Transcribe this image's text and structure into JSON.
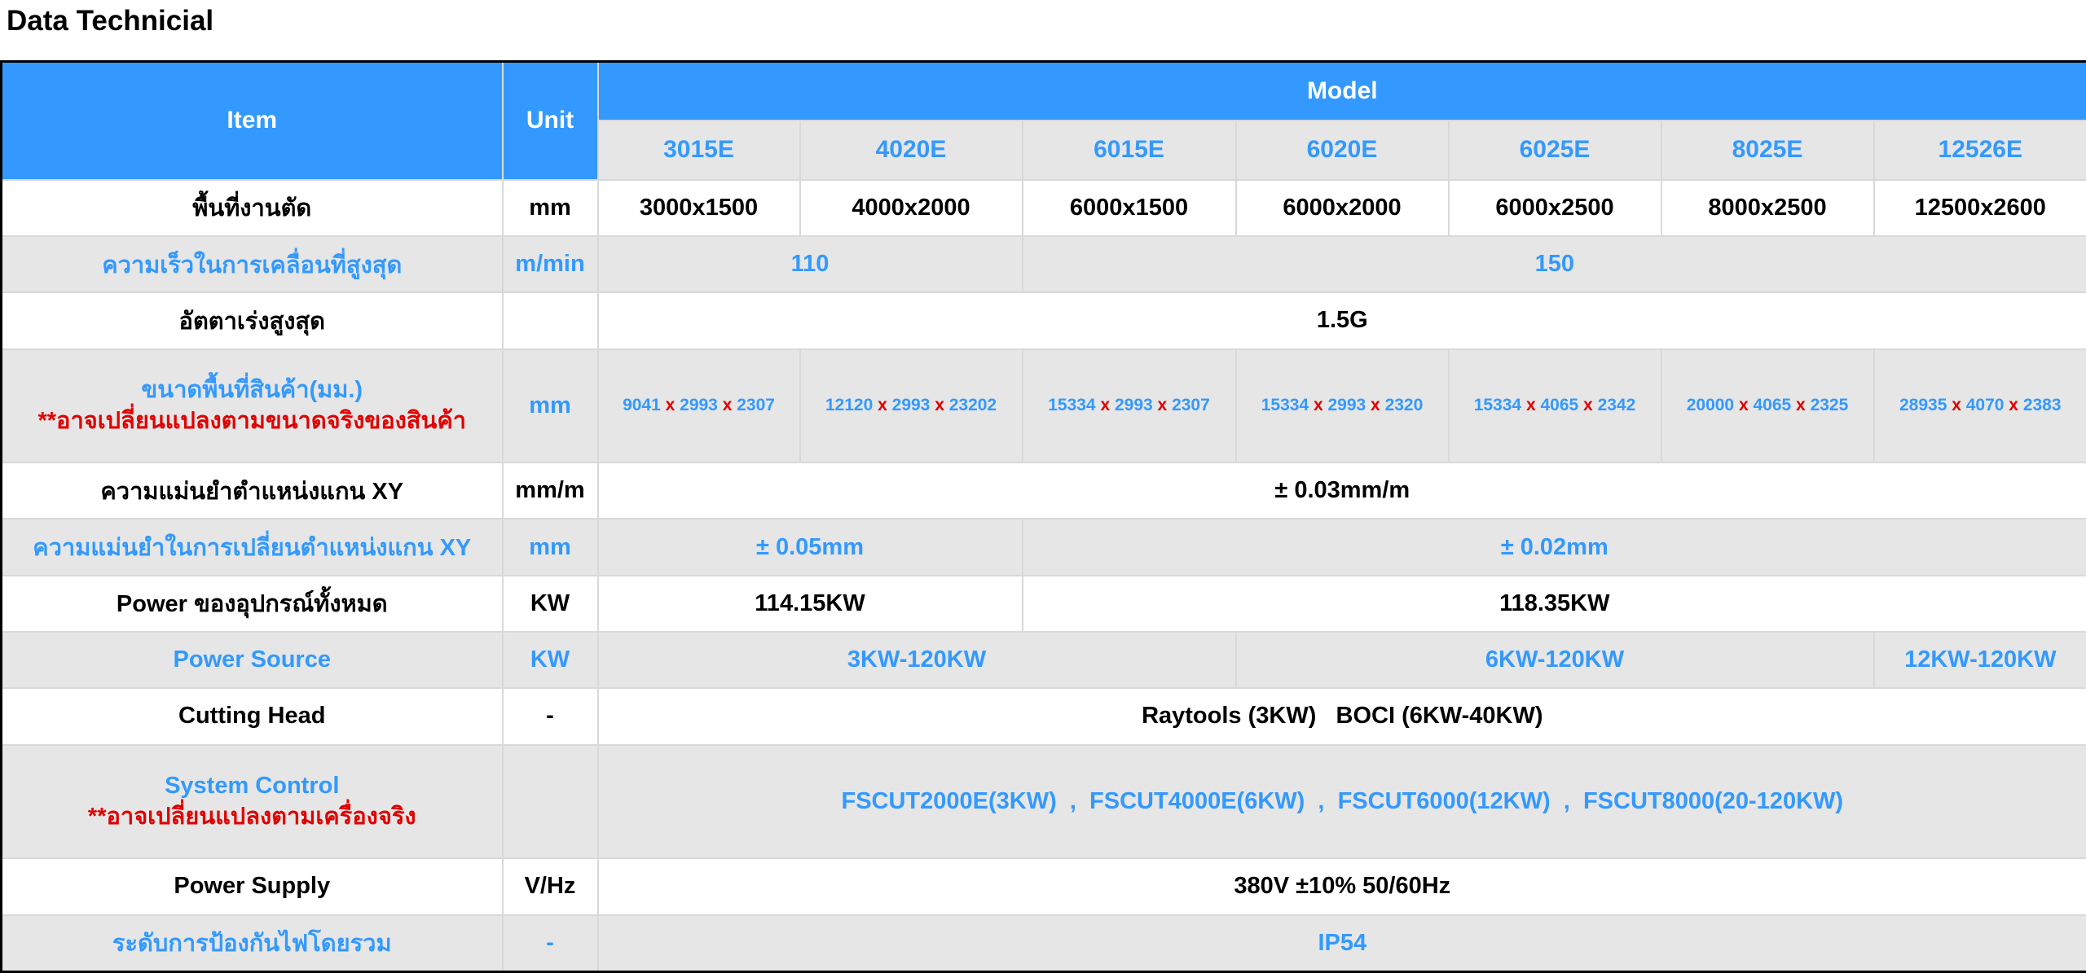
{
  "title": "Data Technicial",
  "header": {
    "item": "Item",
    "unit": "Unit",
    "model": "Model",
    "models": [
      "3015E",
      "4020E",
      "6015E",
      "6020E",
      "6025E",
      "8025E",
      "12526E"
    ]
  },
  "rows": {
    "work_area": {
      "item": "พื้นที่งานตัด",
      "unit": "mm",
      "values": [
        "3000x1500",
        "4000x2000",
        "6000x1500",
        "6000x2000",
        "6000x2500",
        "8000x2500",
        "12500x2600"
      ]
    },
    "max_speed": {
      "item": "ความเร็วในการเคลื่อนที่สูงสุด",
      "unit": "m/min",
      "values": [
        "110",
        "150"
      ]
    },
    "max_accel": {
      "item": "อัตตาเร่งสูงสุด",
      "unit": "",
      "value": "1.5G"
    },
    "footprint": {
      "item": "ขนาดพื้นที่สินค้า(มม.)",
      "note": "**อาจเปลี่ยนแปลงตามขนาดจริงของสินค้า",
      "unit": "mm",
      "separator": "x",
      "values": [
        [
          "9041",
          "2993",
          "2307"
        ],
        [
          "12120",
          "2993",
          "23202"
        ],
        [
          "15334",
          "2993",
          "2307"
        ],
        [
          "15334",
          "2993",
          "2320"
        ],
        [
          "15334",
          "4065",
          "2342"
        ],
        [
          "20000",
          "4065",
          "2325"
        ],
        [
          "28935",
          "4070",
          "2383"
        ]
      ]
    },
    "xy_accuracy": {
      "item": "ความแม่นยำตำแหน่งแกน XY",
      "unit": "mm/m",
      "value": "± 0.03mm/m"
    },
    "xy_repeat": {
      "item": "ความแม่นยำในการเปลี่ยนตำแหน่งแกน XY",
      "unit": "mm",
      "values": [
        "± 0.05mm",
        "± 0.02mm"
      ]
    },
    "total_power": {
      "item": "Power ของอุปกรณ์ทั้งหมด",
      "unit": "KW",
      "values": [
        "114.15KW",
        "118.35KW"
      ]
    },
    "power_source": {
      "item": "Power Source",
      "unit": "KW",
      "values": [
        "3KW-120KW",
        "6KW-120KW",
        "12KW-120KW"
      ]
    },
    "cutting_head": {
      "item": "Cutting Head",
      "unit": "-",
      "value": "Raytools (3KW)   BOCI (6KW-40KW)"
    },
    "system_control": {
      "item": "System Control",
      "note": "**อาจเปลี่ยนแปลงตามเครื่องจริง",
      "unit": "",
      "value": "FSCUT2000E(3KW)  ,  FSCUT4000E(6KW)  ,  FSCUT6000(12KW)  ,  FSCUT8000(20-120KW)"
    },
    "power_supply": {
      "item": "Power Supply",
      "unit": "V/Hz",
      "value": "380V ±10% 50/60Hz"
    },
    "protection": {
      "item": "ระดับการป้องกันไฟโดยรวม",
      "unit": "-",
      "value": "IP54"
    }
  },
  "colors": {
    "header_blue": "#3399ff",
    "row_gray": "#e6e6e6",
    "accent_red": "#e00000"
  }
}
